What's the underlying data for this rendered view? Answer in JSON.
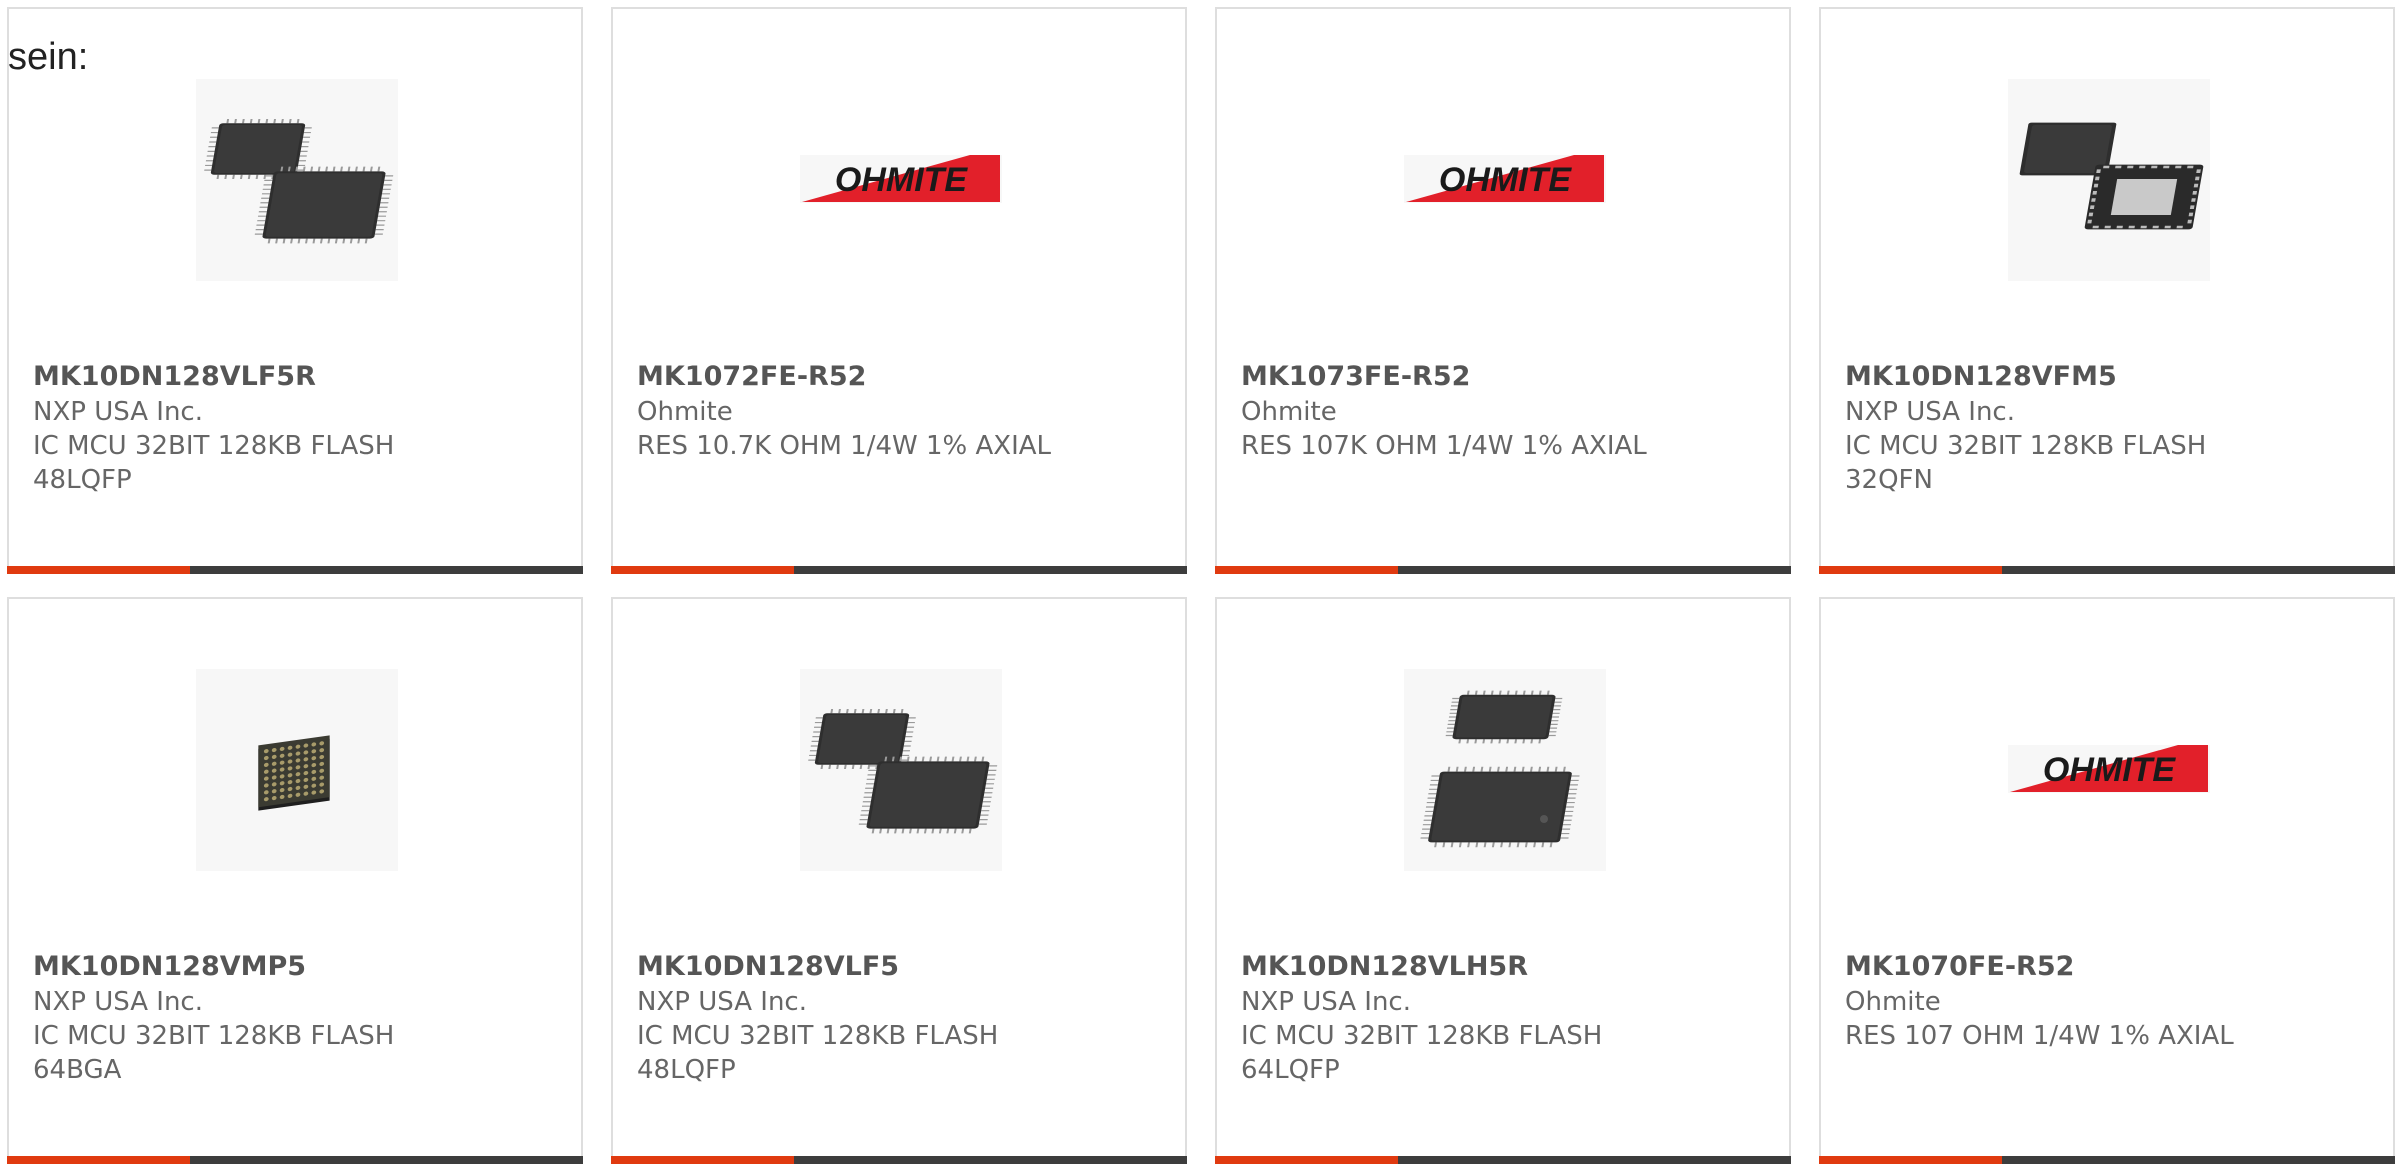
{
  "intro_text": "sein:",
  "colors": {
    "accent": "#e03a10",
    "bar_dark": "#3d3d3d",
    "ohmite_red": "#e2202a"
  },
  "products": [
    {
      "part_number": "MK10DN128VLF5R",
      "manufacturer": "NXP USA Inc.",
      "description": "IC MCU 32BIT 128KB FLASH\n48LQFP",
      "image": "lqfp-chip-pair-icon"
    },
    {
      "part_number": "MK1072FE-R52",
      "manufacturer": "Ohmite",
      "description": "RES 10.7K OHM 1/4W 1% AXIAL",
      "image": "ohmite-logo",
      "logo_text": "OHMITE"
    },
    {
      "part_number": "MK1073FE-R52",
      "manufacturer": "Ohmite",
      "description": "RES 107K OHM 1/4W 1% AXIAL",
      "image": "ohmite-logo",
      "logo_text": "OHMITE"
    },
    {
      "part_number": "MK10DN128VFM5",
      "manufacturer": "NXP USA Inc.",
      "description": "IC MCU 32BIT 128KB FLASH\n32QFN",
      "image": "qfn-chip-pair-icon"
    },
    {
      "part_number": "MK10DN128VMP5",
      "manufacturer": "NXP USA Inc.",
      "description": "IC MCU 32BIT 128KB FLASH\n64BGA",
      "image": "bga-chip-icon"
    },
    {
      "part_number": "MK10DN128VLF5",
      "manufacturer": "NXP USA Inc.",
      "description": "IC MCU 32BIT 128KB FLASH\n48LQFP",
      "image": "lqfp-chip-pair-icon"
    },
    {
      "part_number": "MK10DN128VLH5R",
      "manufacturer": "NXP USA Inc.",
      "description": "IC MCU 32BIT 128KB FLASH\n64LQFP",
      "image": "lqfp-chip-stack-icon"
    },
    {
      "part_number": "MK1070FE-R52",
      "manufacturer": "Ohmite",
      "description": "RES 107 OHM 1/4W 1% AXIAL",
      "image": "ohmite-logo",
      "logo_text": "OHMITE"
    }
  ]
}
